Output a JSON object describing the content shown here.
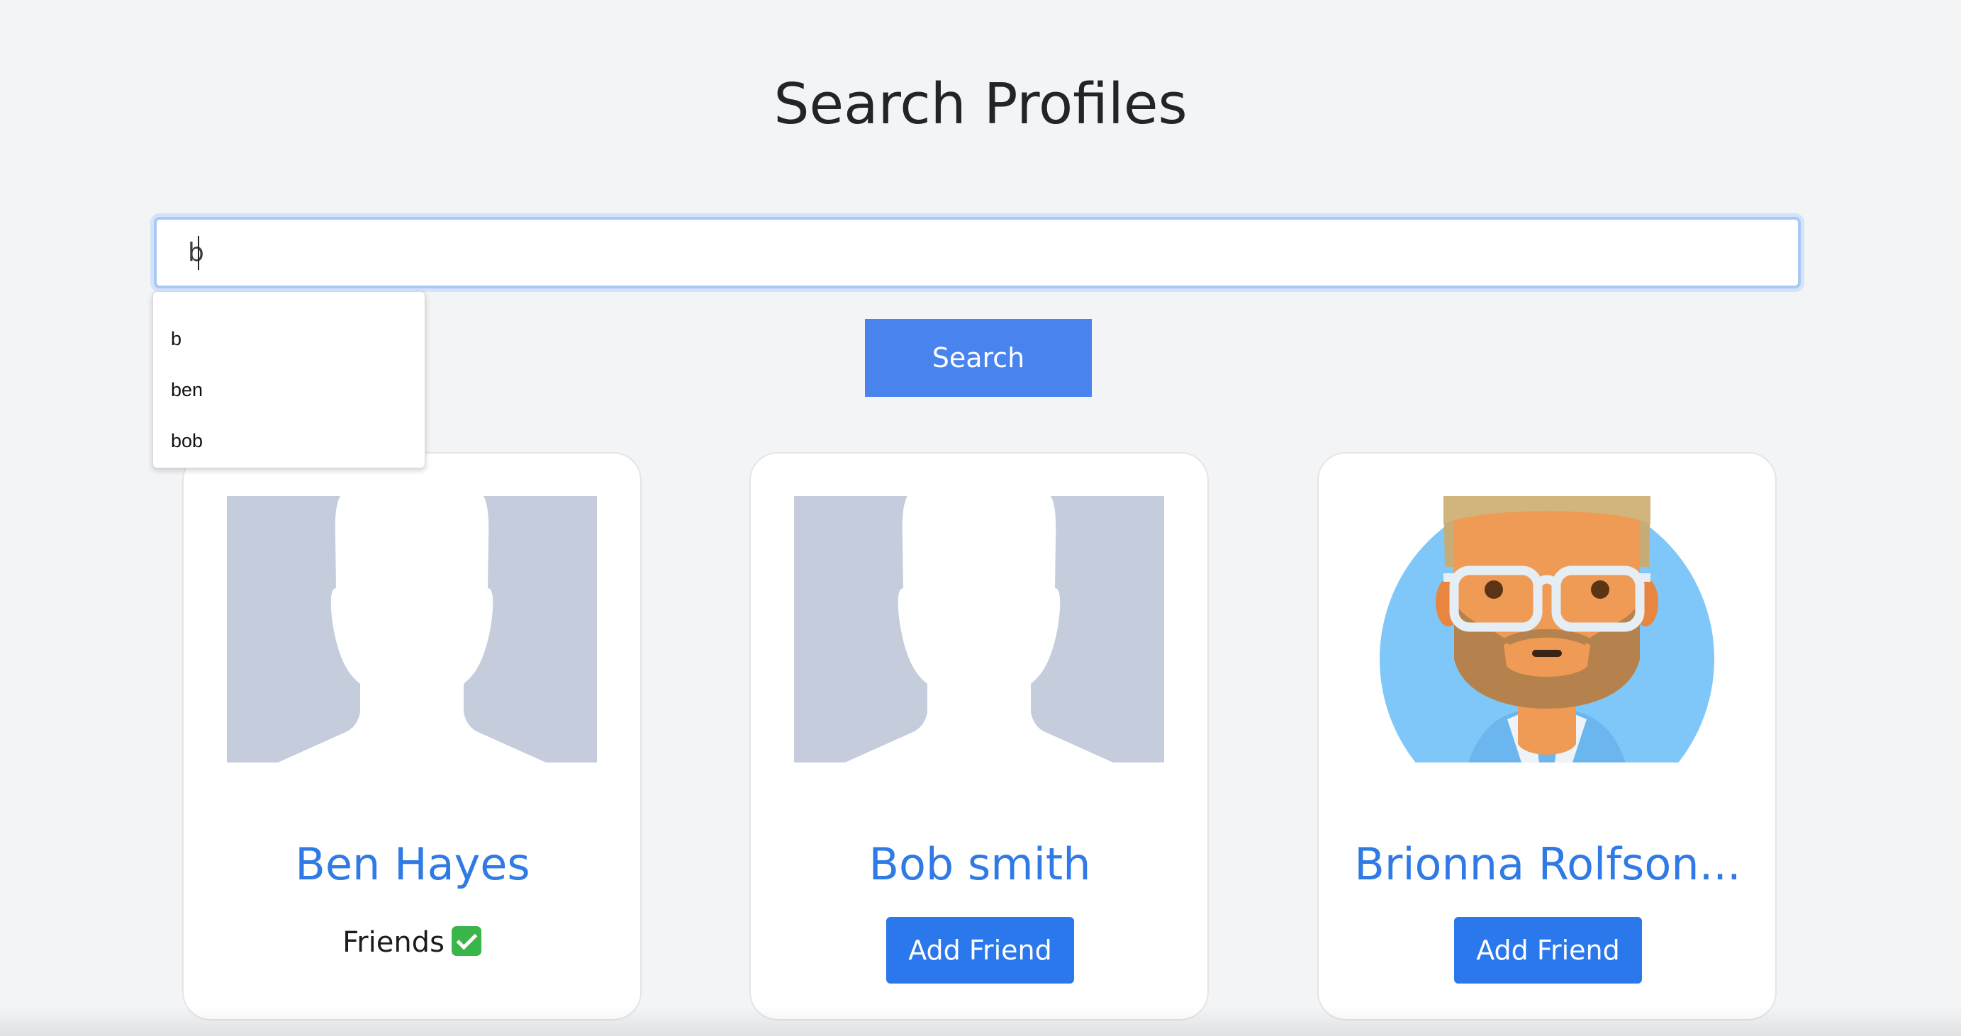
{
  "page": {
    "title": "Search Profiles"
  },
  "search": {
    "value": "b",
    "button_label": "Search"
  },
  "autocomplete": {
    "items": [
      "b",
      "ben",
      "bob"
    ]
  },
  "profiles": [
    {
      "name": "Ben Hayes",
      "avatar": "default-silhouette",
      "status": "Friends",
      "status_icon": "check-icon"
    },
    {
      "name": "Bob smith",
      "avatar": "default-silhouette",
      "action_label": "Add Friend"
    },
    {
      "name": "Brionna Rolfson...",
      "avatar": "illustrated-man-glasses-beard",
      "action_label": "Add Friend"
    }
  ],
  "colors": {
    "background": "#f3f4f6",
    "primary": "#2a78ec",
    "search_button": "#4883ee",
    "name_link": "#2f7ae5",
    "silhouette_bg": "#c5ccdc"
  }
}
